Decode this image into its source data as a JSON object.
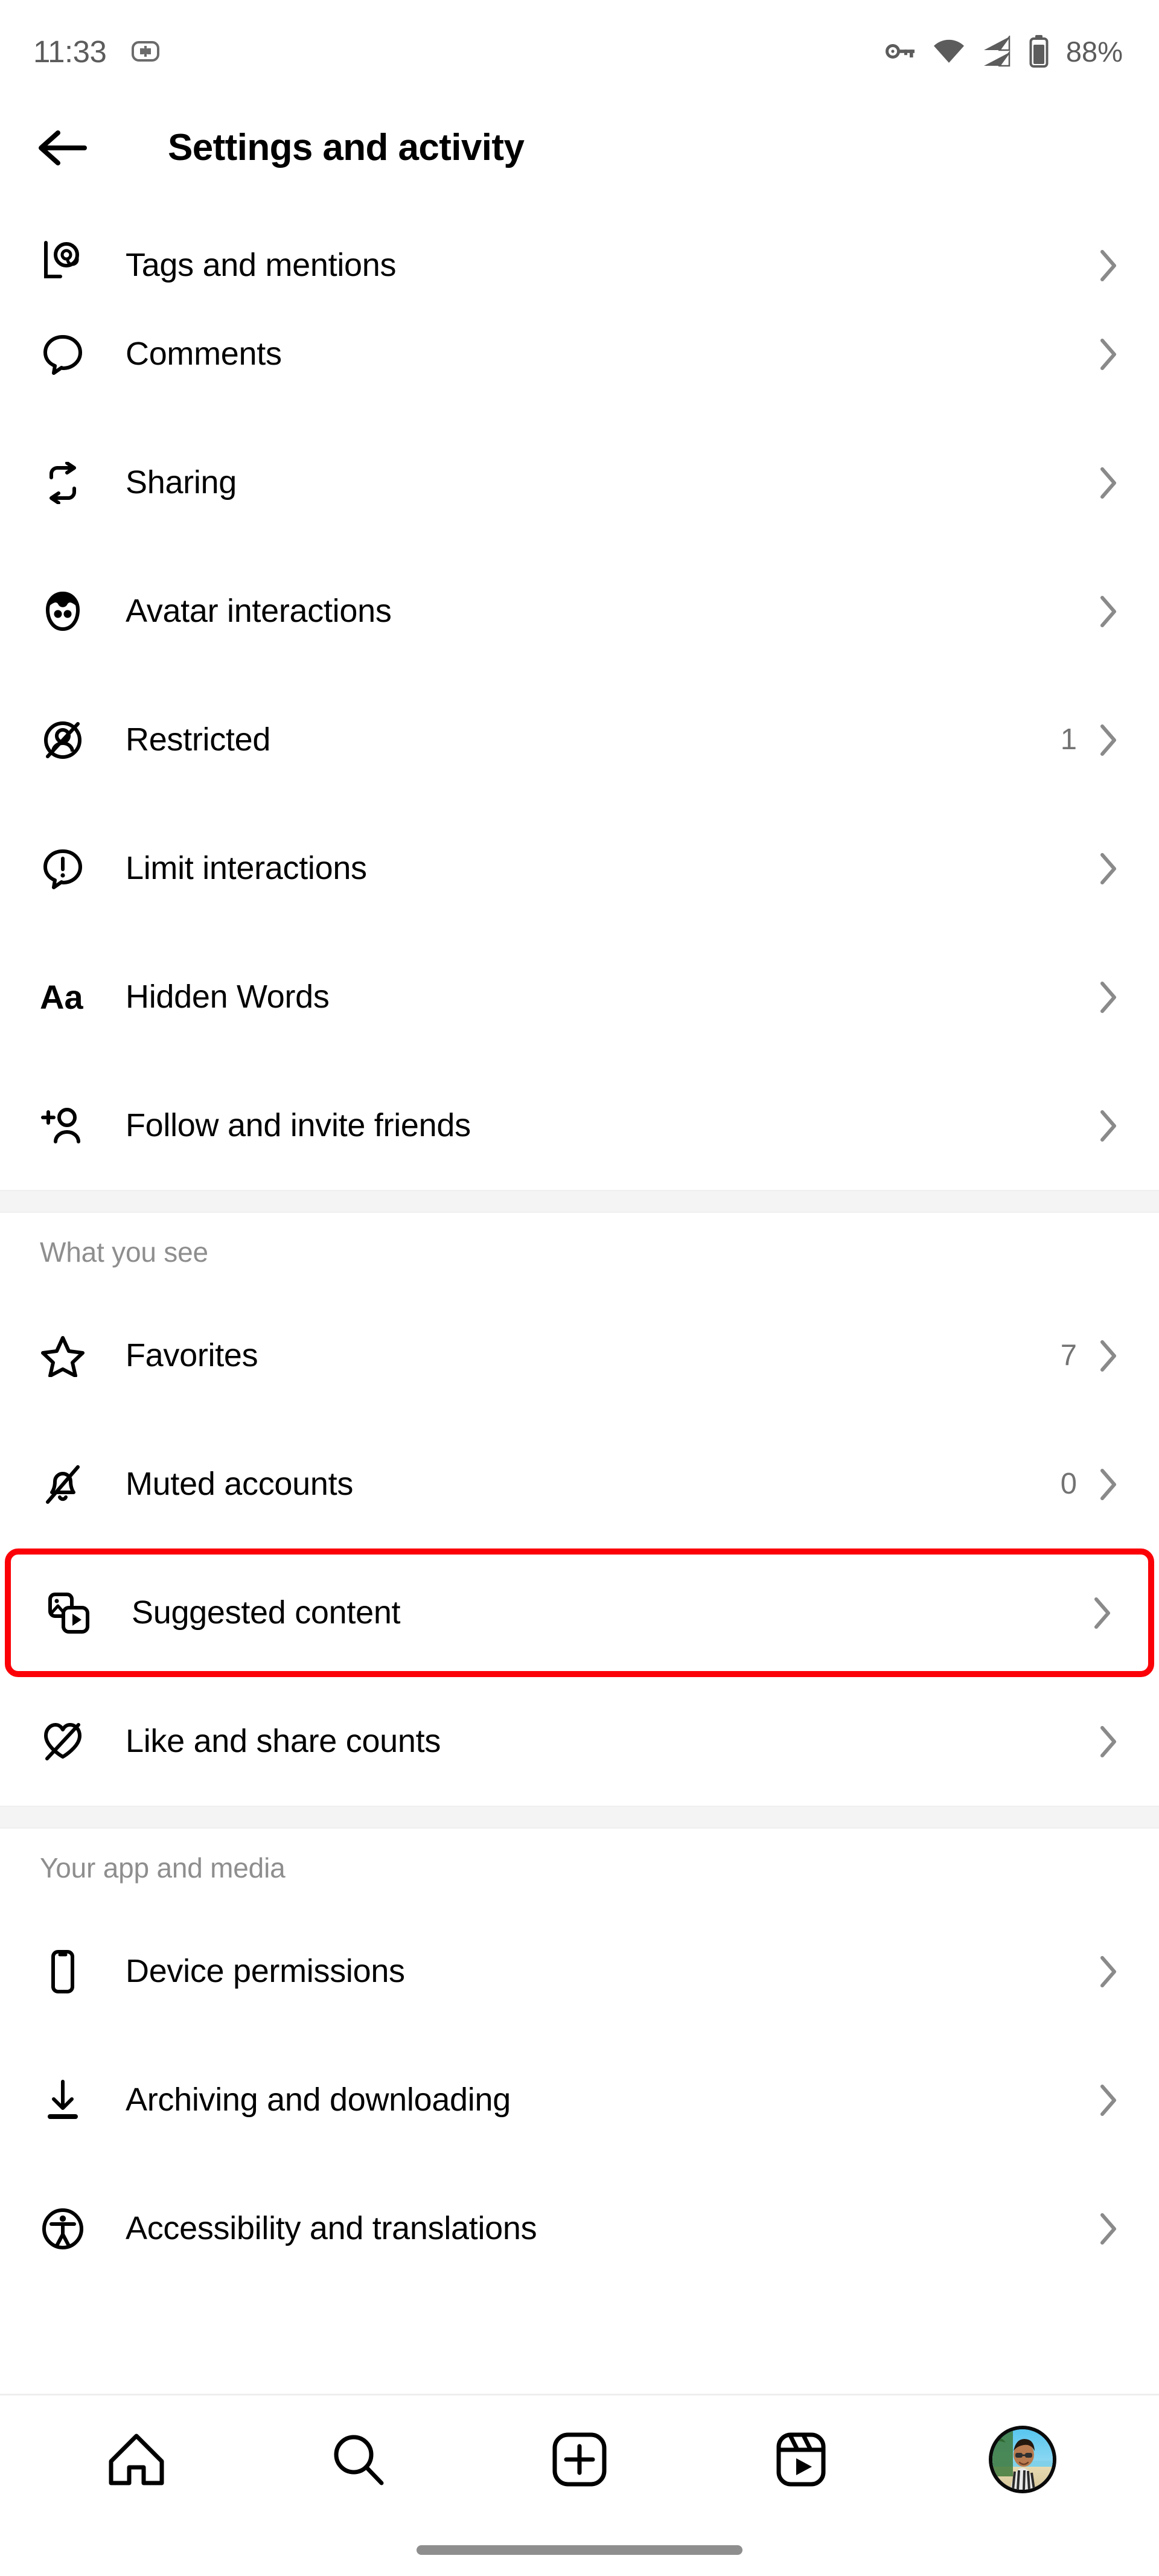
{
  "status_bar": {
    "time": "11:33",
    "battery_percent": "88%",
    "icons": [
      "split-screen-icon",
      "vpn-key-icon",
      "wifi-icon",
      "cellular-signal-icon",
      "battery-icon"
    ]
  },
  "header": {
    "title": "Settings and activity",
    "back_icon": "back-arrow-icon"
  },
  "colors": {
    "highlight": "#fb0007",
    "label": "#000000",
    "value": "#737373",
    "section_header": "#8e8e8e",
    "band": "#f4f4f4"
  },
  "sections": [
    {
      "id": "how-others-interact",
      "header": null,
      "rows": [
        {
          "label": "Tags and mentions",
          "value": "",
          "icon": "tag-mention-icon",
          "clipped": true,
          "highlight": false
        },
        {
          "label": "Comments",
          "value": "",
          "icon": "comment-bubble-icon",
          "highlight": false
        },
        {
          "label": "Sharing",
          "value": "",
          "icon": "repost-arrows-icon",
          "highlight": false
        },
        {
          "label": "Avatar interactions",
          "value": "",
          "icon": "avatar-face-icon",
          "highlight": false
        },
        {
          "label": "Restricted",
          "value": "1",
          "icon": "restricted-person-icon",
          "highlight": false
        },
        {
          "label": "Limit interactions",
          "value": "",
          "icon": "limit-exclamation-bubble-icon",
          "highlight": false
        },
        {
          "label": "Hidden Words",
          "value": "",
          "icon": "hidden-words-aa-icon",
          "highlight": false
        },
        {
          "label": "Follow and invite friends",
          "value": "",
          "icon": "add-person-icon",
          "highlight": false
        }
      ]
    },
    {
      "id": "what-you-see",
      "header": "What you see",
      "rows": [
        {
          "label": "Favorites",
          "value": "7",
          "icon": "star-icon",
          "highlight": false
        },
        {
          "label": "Muted accounts",
          "value": "0",
          "icon": "muted-bell-icon",
          "highlight": false
        },
        {
          "label": "Suggested content",
          "value": "",
          "icon": "suggested-media-play-icon",
          "highlight": true
        },
        {
          "label": "Like and share counts",
          "value": "",
          "icon": "crossed-heart-icon",
          "highlight": false
        }
      ]
    },
    {
      "id": "your-app-and-media",
      "header": "Your app and media",
      "rows": [
        {
          "label": "Device permissions",
          "value": "",
          "icon": "phone-device-icon",
          "highlight": false
        },
        {
          "label": "Archiving and downloading",
          "value": "",
          "icon": "download-arrow-icon",
          "highlight": false
        },
        {
          "label": "Accessibility and translations",
          "value": "",
          "icon": "accessibility-person-icon",
          "highlight": false
        }
      ]
    }
  ],
  "bottom_nav": [
    {
      "name": "home",
      "icon": "home-icon"
    },
    {
      "name": "search",
      "icon": "search-icon"
    },
    {
      "name": "create",
      "icon": "plus-square-icon"
    },
    {
      "name": "reels",
      "icon": "reels-play-icon"
    },
    {
      "name": "profile",
      "icon": "profile-avatar"
    }
  ]
}
